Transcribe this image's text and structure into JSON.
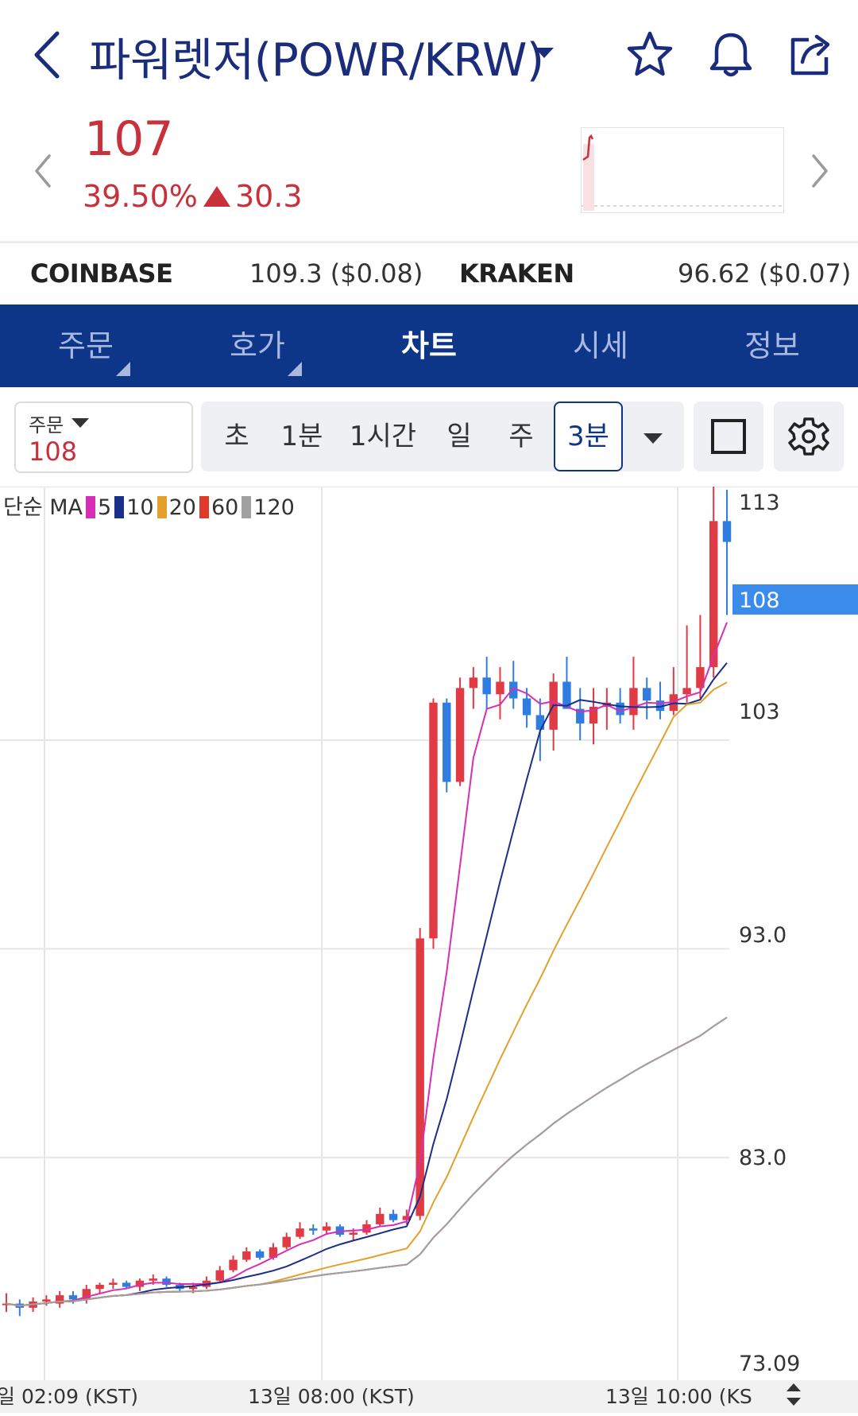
{
  "header": {
    "title": "파워렛저(POWR/KRW)",
    "icons": [
      "back-chevron-icon",
      "dropdown-caret-icon",
      "star-icon",
      "bell-icon",
      "share-icon"
    ]
  },
  "ticker": {
    "price": "107",
    "change_pct": "39.50%",
    "change_value": "30.3",
    "color_up": "#c8313c"
  },
  "exchanges": [
    {
      "name": "COINBASE",
      "value": "109.3 ($0.08)"
    },
    {
      "name": "KRAKEN",
      "value": "96.62 ($0.07)"
    }
  ],
  "tabs": [
    {
      "label": "주문",
      "active": false
    },
    {
      "label": "호가",
      "active": false
    },
    {
      "label": "차트",
      "active": true
    },
    {
      "label": "시세",
      "active": false
    },
    {
      "label": "정보",
      "active": false
    }
  ],
  "toolbar": {
    "order_label": "주문",
    "order_value": "108",
    "intervals": [
      "초",
      "1분",
      "1시간",
      "일",
      "주",
      "3분"
    ],
    "active_interval": "3분"
  },
  "chart": {
    "legend": {
      "prefix": "단순 MA",
      "items": [
        {
          "label": "5",
          "color": "#d62fb5"
        },
        {
          "label": "10",
          "color": "#1a2f8a"
        },
        {
          "label": "20",
          "color": "#e3a02b"
        },
        {
          "label": "60",
          "color": "#e03a2b"
        },
        {
          "label": "120",
          "color": "#a0a0a0"
        }
      ]
    },
    "y_ticks": [
      "113",
      "103",
      "93.0",
      "83.0",
      "73.09"
    ],
    "current_price_label": "108",
    "x_ticks": [
      "일 02:09 (KST)",
      "13일 08:00 (KST)",
      "13일 10:00 (KS"
    ],
    "up_color": "#e03a45",
    "down_color": "#2f7de0",
    "accent": "#0d3689"
  },
  "chart_data": {
    "type": "candlestick",
    "y_range": [
      73.09,
      115
    ],
    "candles": [
      [
        76.0,
        76.5,
        75.6,
        76.0
      ],
      [
        76.0,
        76.2,
        75.4,
        75.8
      ],
      [
        75.8,
        76.3,
        75.6,
        76.1
      ],
      [
        76.1,
        76.4,
        75.9,
        76.2
      ],
      [
        76.0,
        76.6,
        75.8,
        76.4
      ],
      [
        76.4,
        76.6,
        76.0,
        76.2
      ],
      [
        76.2,
        76.9,
        76.0,
        76.7
      ],
      [
        76.7,
        77.0,
        76.5,
        76.9
      ],
      [
        76.9,
        77.2,
        76.7,
        77.0
      ],
      [
        77.0,
        77.1,
        76.7,
        76.8
      ],
      [
        76.8,
        77.2,
        76.6,
        77.1
      ],
      [
        77.1,
        77.4,
        76.9,
        77.2
      ],
      [
        77.2,
        77.3,
        76.8,
        76.9
      ],
      [
        76.9,
        77.0,
        76.6,
        76.7
      ],
      [
        76.7,
        77.0,
        76.5,
        76.8
      ],
      [
        76.8,
        77.3,
        76.7,
        77.1
      ],
      [
        77.1,
        77.8,
        77.0,
        77.6
      ],
      [
        77.6,
        78.3,
        77.5,
        78.1
      ],
      [
        78.1,
        78.7,
        78.0,
        78.5
      ],
      [
        78.5,
        78.6,
        78.1,
        78.2
      ],
      [
        78.2,
        78.9,
        78.1,
        78.7
      ],
      [
        78.7,
        79.4,
        78.6,
        79.2
      ],
      [
        79.2,
        79.9,
        79.1,
        79.6
      ],
      [
        79.6,
        79.8,
        79.3,
        79.5
      ],
      [
        79.5,
        79.9,
        79.3,
        79.7
      ],
      [
        79.7,
        79.8,
        79.2,
        79.3
      ],
      [
        79.3,
        79.6,
        79.0,
        79.4
      ],
      [
        79.4,
        80.0,
        79.3,
        79.8
      ],
      [
        79.8,
        80.6,
        79.7,
        80.3
      ],
      [
        80.3,
        80.5,
        79.9,
        80.0
      ],
      [
        80.0,
        80.5,
        79.8,
        80.2
      ],
      [
        80.2,
        94.0,
        80.0,
        93.5
      ],
      [
        93.5,
        105.0,
        93.0,
        104.8
      ],
      [
        104.8,
        105.0,
        100.5,
        101.0
      ],
      [
        101.0,
        106.0,
        100.8,
        105.5
      ],
      [
        105.5,
        106.5,
        104.5,
        106.0
      ],
      [
        106.0,
        107.0,
        104.5,
        105.2
      ],
      [
        105.2,
        106.5,
        104.0,
        105.8
      ],
      [
        105.8,
        106.8,
        104.5,
        105.0
      ],
      [
        105.0,
        105.5,
        103.6,
        104.2
      ],
      [
        104.2,
        105.0,
        102.0,
        103.5
      ],
      [
        103.5,
        106.2,
        102.5,
        105.8
      ],
      [
        105.8,
        107.0,
        104.5,
        104.5
      ],
      [
        104.5,
        105.5,
        103.0,
        103.8
      ],
      [
        103.8,
        105.5,
        102.8,
        104.6
      ],
      [
        104.6,
        105.5,
        103.5,
        104.8
      ],
      [
        104.8,
        105.5,
        103.8,
        104.2
      ],
      [
        104.2,
        107.0,
        103.5,
        105.5
      ],
      [
        105.5,
        106.0,
        104.0,
        104.9
      ],
      [
        104.9,
        105.8,
        104.0,
        104.4
      ],
      [
        104.4,
        106.5,
        104.2,
        105.2
      ],
      [
        105.2,
        108.5,
        104.8,
        105.5
      ],
      [
        105.5,
        109.0,
        105.0,
        106.5
      ],
      [
        106.5,
        120.0,
        106.0,
        113.5
      ],
      [
        113.5,
        115.0,
        109.0,
        112.5
      ]
    ]
  }
}
